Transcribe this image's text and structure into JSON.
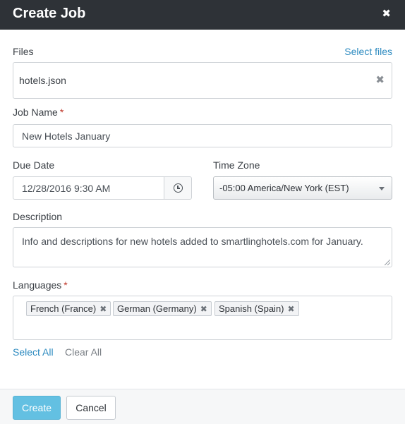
{
  "dialog": {
    "title": "Create Job",
    "close_glyph": "✖"
  },
  "files": {
    "label": "Files",
    "select_link": "Select files",
    "items": [
      {
        "name": "hotels.json",
        "remove_glyph": "✖"
      }
    ]
  },
  "job_name": {
    "label": "Job Name",
    "required_mark": "*",
    "value": "New Hotels January"
  },
  "due_date": {
    "label": "Due Date",
    "value": "12/28/2016 9:30 AM",
    "picker_icon": "clock-icon"
  },
  "time_zone": {
    "label": "Time Zone",
    "selected": "-05:00 America/New York (EST)"
  },
  "description": {
    "label": "Description",
    "value": "Info and descriptions for new hotels added to smartlinghotels.com for January."
  },
  "languages": {
    "label": "Languages",
    "required_mark": "*",
    "selected": [
      {
        "label": "French (France)",
        "remove_glyph": "✖"
      },
      {
        "label": "German (Germany)",
        "remove_glyph": "✖"
      },
      {
        "label": "Spanish (Spain)",
        "remove_glyph": "✖"
      }
    ],
    "select_all": "Select All",
    "clear_all": "Clear All"
  },
  "footer": {
    "create_label": "Create",
    "cancel_label": "Cancel"
  },
  "colors": {
    "header_bg": "#2e3237",
    "link": "#2e8bc0",
    "required": "#c0392b",
    "primary_button": "#63c0e2"
  }
}
